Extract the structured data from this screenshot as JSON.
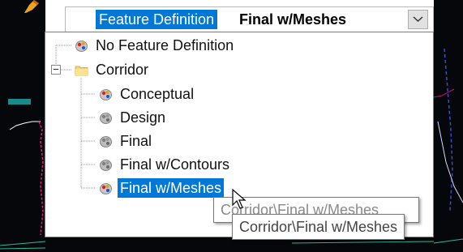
{
  "combo": {
    "label": "Feature Definition",
    "value": "Final w/Meshes"
  },
  "tree": {
    "items": [
      {
        "label": "No Feature Definition",
        "icon": "feature-palette-icon"
      },
      {
        "label": "Corridor",
        "icon": "folder-icon",
        "expanded": true
      },
      {
        "label": "Conceptual",
        "icon": "feature-palette-icon"
      },
      {
        "label": "Design",
        "icon": "feature-palette-gray-icon"
      },
      {
        "label": "Final",
        "icon": "feature-palette-gray-icon"
      },
      {
        "label": "Final w/Contours",
        "icon": "feature-palette-gray-icon"
      },
      {
        "label": "Final w/Meshes",
        "icon": "feature-palette-icon",
        "selected": true
      }
    ]
  },
  "tooltip": {
    "back_text": "Corridor\\Final w/Meshes",
    "front_text": "Corridor\\Final w/Meshes"
  },
  "colors": {
    "selection": "#0078d7",
    "background_dark": "#05070a"
  }
}
